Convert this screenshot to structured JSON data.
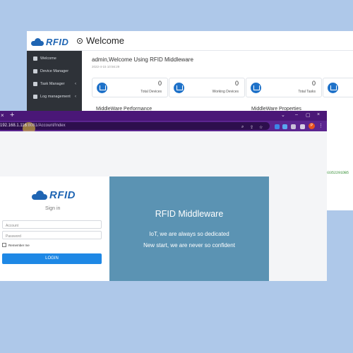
{
  "dashboard": {
    "brand": "RFID",
    "title": "Welcome",
    "sidebar": [
      {
        "label": "Welcome"
      },
      {
        "label": "Device Manager"
      },
      {
        "label": "Task Manager"
      },
      {
        "label": "Log management"
      }
    ],
    "welcome_line": "admin,Welcome Using RFID Middleware",
    "welcome_date": "2022-4-15 10:56:29",
    "stats": [
      {
        "value": "0",
        "label": "Total Devices"
      },
      {
        "value": "0",
        "label": "Working Devices"
      },
      {
        "value": "0",
        "label": "Total Tasks"
      }
    ],
    "sections": [
      "MiddleWare Performance",
      "MiddleWare Properties"
    ],
    "hex_text": "043352291DB5"
  },
  "browser": {
    "tab_close": "×",
    "new_tab": "+",
    "window_controls": [
      "⌄",
      "–",
      "▢",
      "×"
    ],
    "url_host": "192.168.1.116",
    "url_port": ":8081",
    "url_path": "/Account/Index",
    "profile_initial": "P",
    "menu_glyph": "⋮"
  },
  "login": {
    "brand": "RFID",
    "heading": "Sign in",
    "account_placeholder": "Account",
    "password_placeholder": "Password",
    "remember_label": "Remember me",
    "button_label": "LOGIN"
  },
  "promo": {
    "title": "RFID Middleware",
    "line1": "IoT, we are always so dedicated",
    "line2": "New start, we are never so confident"
  }
}
